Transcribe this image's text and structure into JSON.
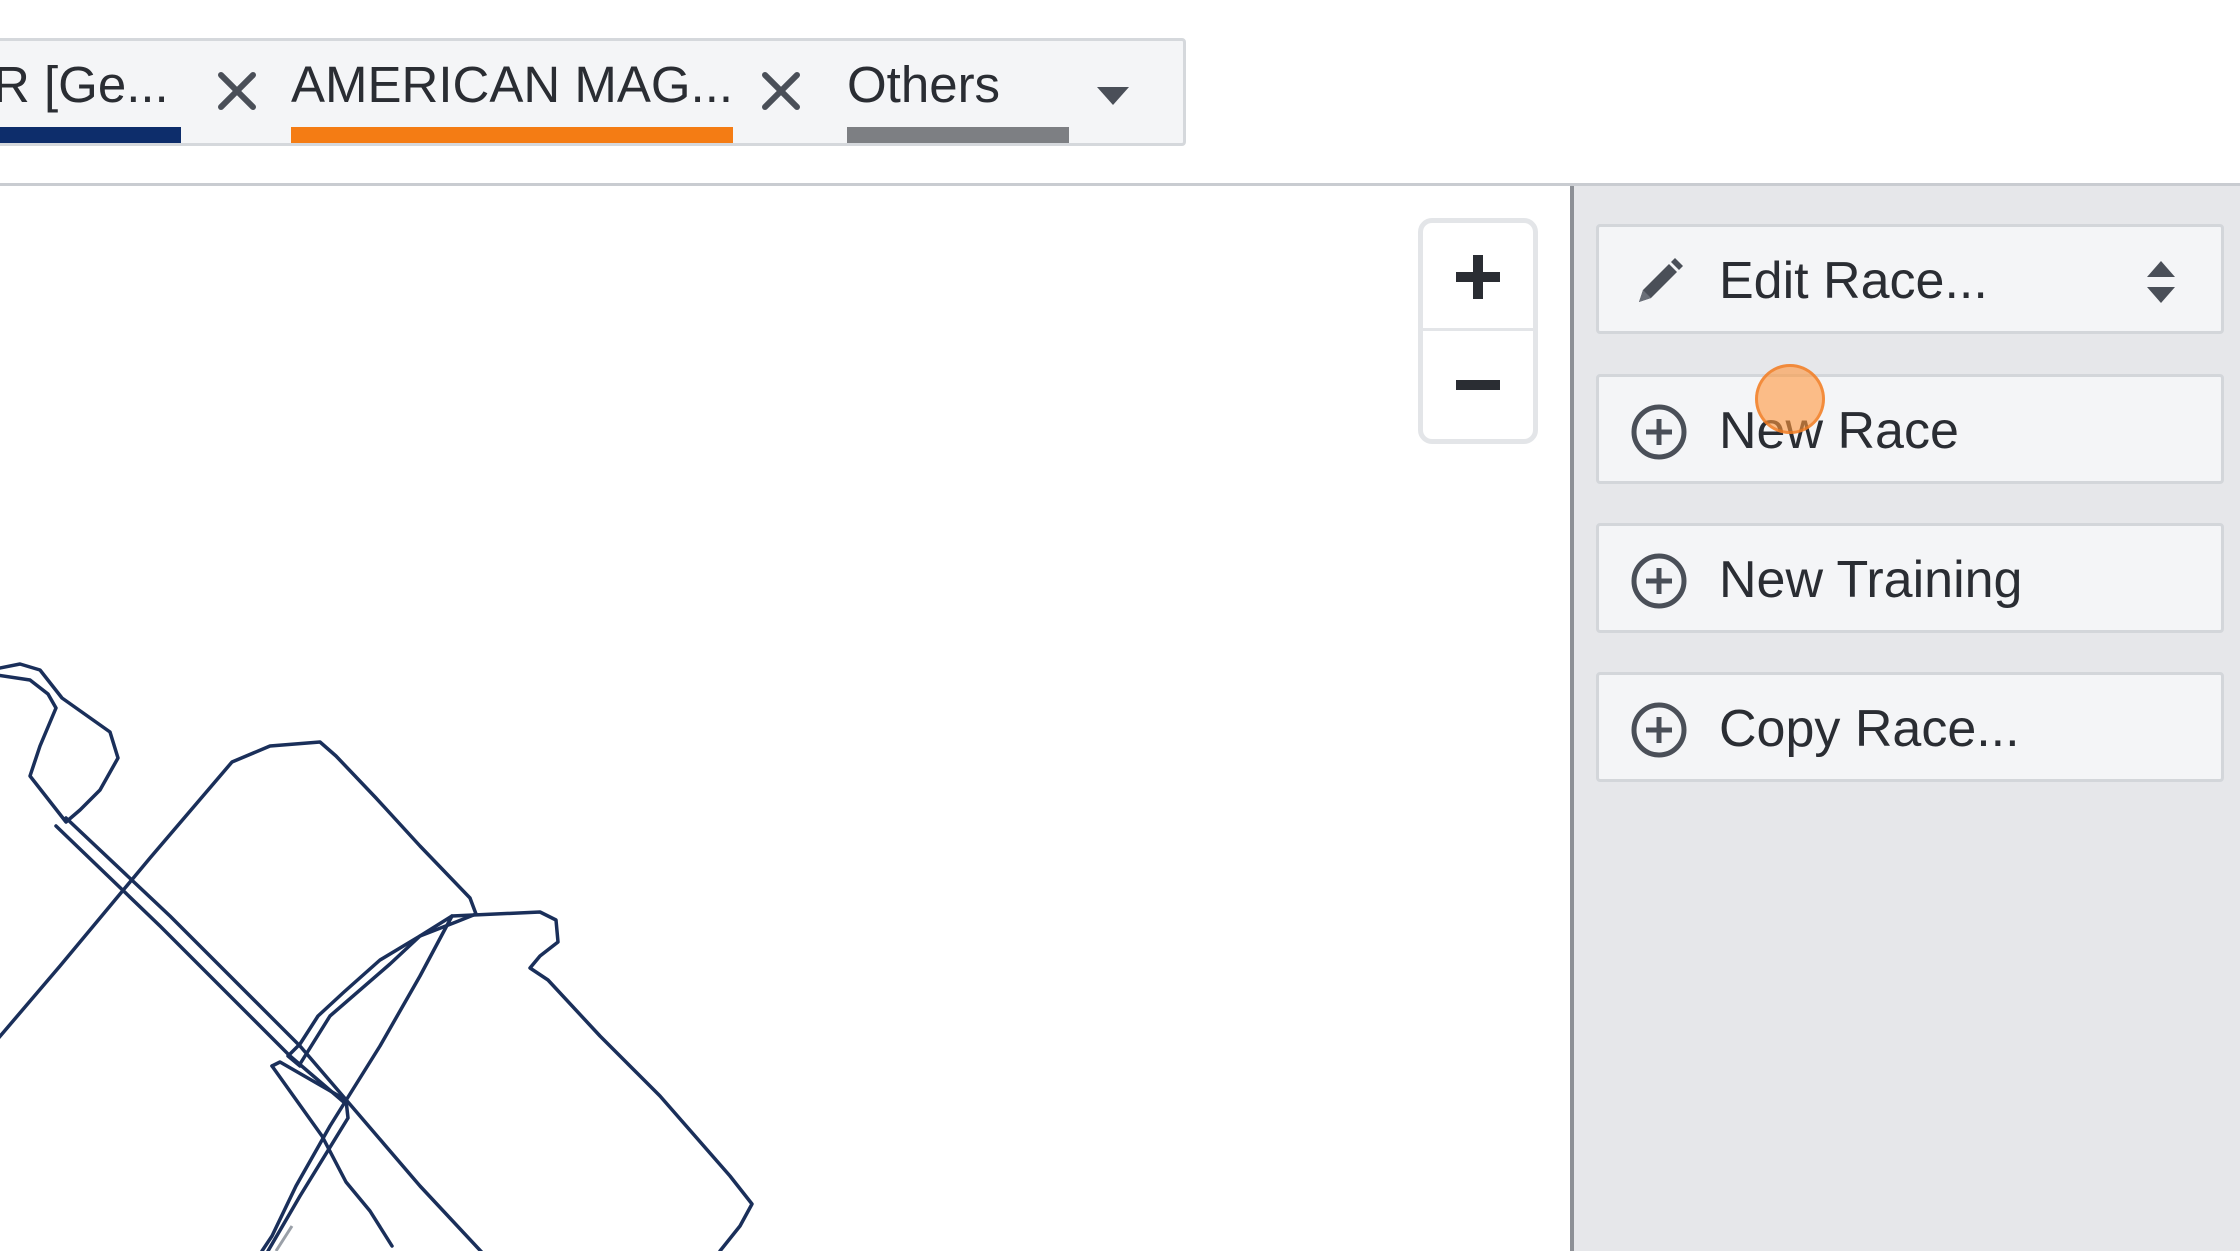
{
  "tabs": [
    {
      "label": "R [Ge...",
      "color": "#0d2d6b",
      "closable": true
    },
    {
      "label": "AMERICAN MAG...",
      "color": "#f47c14",
      "closable": true
    },
    {
      "label": "Others",
      "color": "#7d7f83",
      "closable": false
    }
  ],
  "tab_icons": {
    "close": "close-icon",
    "dropdown": "caret-down-icon"
  },
  "map": {
    "zoom_in_icon": "plus-icon",
    "zoom_out_icon": "minus-icon",
    "track_color": "#1a2f5a"
  },
  "panel": {
    "edit_race": {
      "label": "Edit Race...",
      "icon": "pencil-icon",
      "trailing_icon": "sort-icon"
    },
    "new_race": {
      "label": "New Race",
      "icon": "plus-circle-icon"
    },
    "new_training": {
      "label": "New Training",
      "icon": "plus-circle-icon"
    },
    "copy_race": {
      "label": "Copy Race...",
      "icon": "plus-circle-icon"
    }
  },
  "colors": {
    "panel_bg": "#e6e7ea",
    "text": "#2a2d33",
    "icon": "#4a4f58",
    "cursor_highlight": "#ff963c"
  }
}
